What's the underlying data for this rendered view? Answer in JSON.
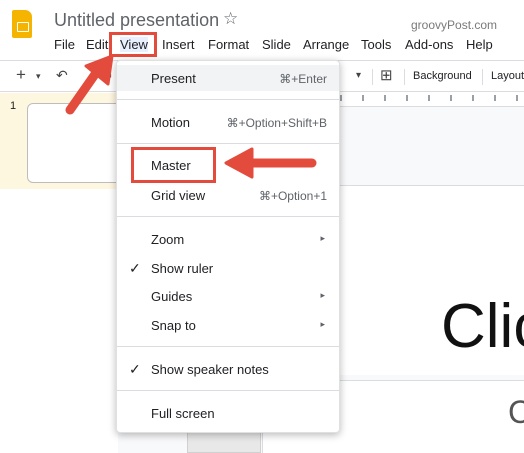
{
  "app": {
    "title": "Untitled presentation",
    "star_icon": "star-outline-icon",
    "watermark": "groovyPost.com"
  },
  "menubar": {
    "items": [
      "File",
      "Edit",
      "View",
      "Insert",
      "Format",
      "Slide",
      "Arrange",
      "Tools",
      "Add-ons",
      "Help"
    ],
    "active": "View"
  },
  "toolbar": {
    "new_slide": "+",
    "background_label": "Background",
    "layout_label": "Layout"
  },
  "filmstrip": {
    "slide_number": "1"
  },
  "slide": {
    "title_text": "Clic",
    "subtitle_text": "C"
  },
  "view_menu": {
    "items": [
      {
        "label": "Present",
        "shortcut": "⌘+Enter"
      },
      {
        "label": "Motion",
        "shortcut": "⌘+Option+Shift+B"
      },
      {
        "label": "Master",
        "shortcut": ""
      },
      {
        "label": "Grid view",
        "shortcut": "⌘+Option+1"
      },
      {
        "label": "Zoom",
        "submenu": true
      },
      {
        "label": "Show ruler",
        "checked": true
      },
      {
        "label": "Guides",
        "submenu": true
      },
      {
        "label": "Snap to",
        "submenu": true
      },
      {
        "label": "Show speaker notes",
        "checked": true
      },
      {
        "label": "Full screen"
      }
    ],
    "check_glyph": "✓",
    "submenu_glyph": "▸"
  },
  "colors": {
    "annotation_red": "#e34b3d",
    "logo_yellow": "#f4b400",
    "filmstrip_bg": "#fef7e0"
  }
}
